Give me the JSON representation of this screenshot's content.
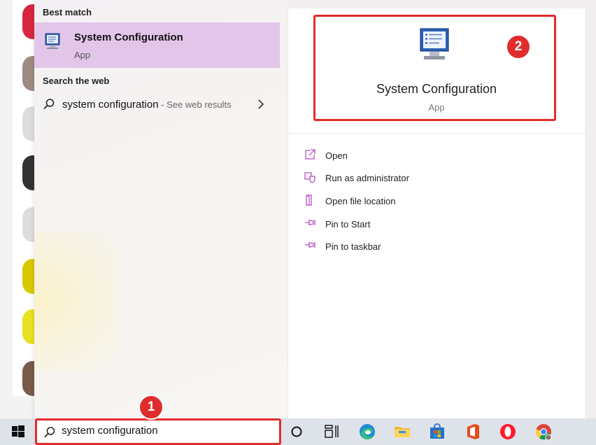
{
  "left_panel": {
    "best_match_title": "Best match",
    "best_match": {
      "name": "System Configuration",
      "type": "App",
      "icon": "system-configuration-icon"
    },
    "web_title": "Search the web",
    "web_result": {
      "query": "system configuration",
      "suffix": " - See web results"
    }
  },
  "detail": {
    "title": "System Configuration",
    "subtitle": "App",
    "actions": [
      {
        "label": "Open",
        "icon": "open-icon"
      },
      {
        "label": "Run as administrator",
        "icon": "shield-icon"
      },
      {
        "label": "Open file location",
        "icon": "folder-icon"
      },
      {
        "label": "Pin to Start",
        "icon": "pin-icon"
      },
      {
        "label": "Pin to taskbar",
        "icon": "pin-icon"
      }
    ]
  },
  "callouts": [
    "1",
    "2"
  ],
  "taskbar": {
    "search_value": "system configuration",
    "apps": [
      "start-icon",
      "cortana-icon",
      "task-view-icon",
      "edge-icon",
      "file-explorer-icon",
      "store-icon",
      "office-icon",
      "opera-icon",
      "chrome-icon"
    ]
  },
  "colors": {
    "highlight": "#e3c5ea",
    "callout": "#e02c2c",
    "accent": "#b146c2"
  }
}
